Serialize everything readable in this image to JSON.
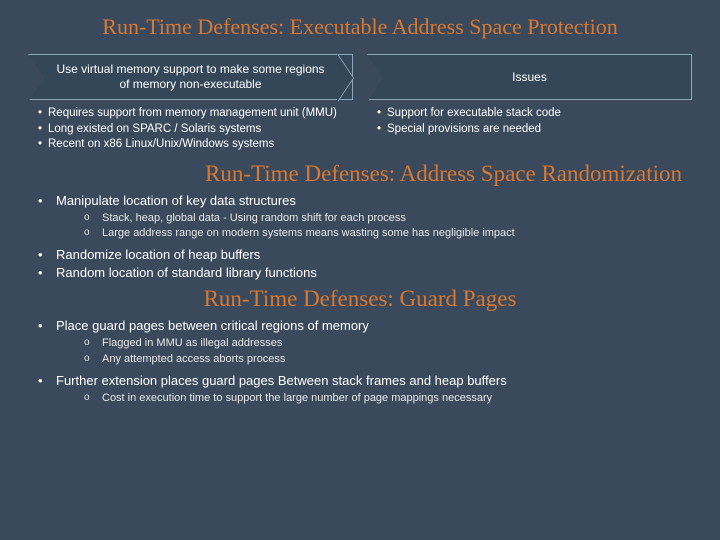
{
  "title1": "Run-Time Defenses: Executable Address Space Protection",
  "box_left_header": "Use virtual memory support to make some regions of memory non-executable",
  "box_right_header": "Issues",
  "left_bullets": [
    "Requires support from memory management unit (MMU)",
    "Long existed on SPARC / Solaris systems",
    "Recent on x86 Linux/Unix/Windows systems"
  ],
  "right_bullets": [
    "Support for executable stack code",
    "Special provisions are needed"
  ],
  "title2": "Run-Time Defenses: Address Space Randomization",
  "asr": [
    {
      "text": "Manipulate location of key data structures",
      "sub": [
        "Stack, heap, global data - Using random shift for each process",
        "Large address range on modern systems means wasting some has negligible impact"
      ]
    },
    {
      "text": "Randomize location of heap buffers"
    },
    {
      "text": "Random location of standard library functions"
    }
  ],
  "title3": "Run-Time Defenses: Guard Pages",
  "gp": [
    {
      "text": "Place guard pages between critical regions of memory",
      "sub": [
        "Flagged in MMU as illegal addresses",
        "Any attempted access aborts process"
      ]
    },
    {
      "text": "Further extension places guard pages Between stack frames and heap buffers",
      "sub": [
        "Cost in execution time to support the large number of page mappings necessary"
      ]
    }
  ]
}
